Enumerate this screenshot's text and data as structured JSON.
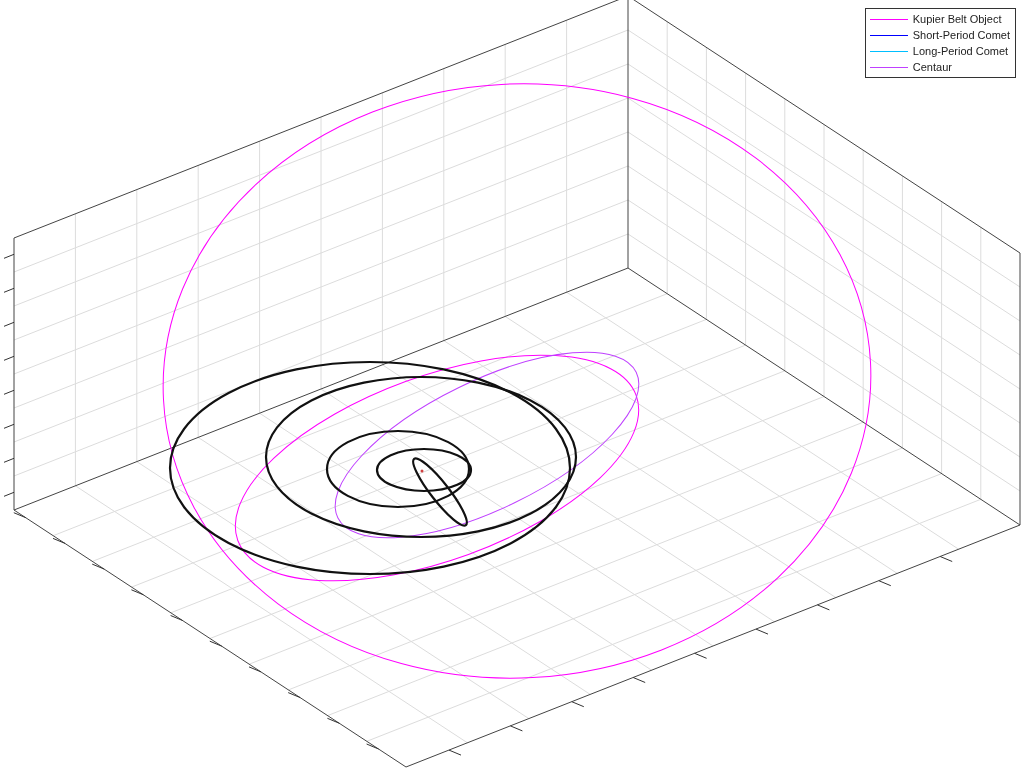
{
  "legend": {
    "entries": [
      {
        "label": "Kupier Belt Object",
        "color": "#ff00ff"
      },
      {
        "label": "Short-Period Comet",
        "color": "#0000ff"
      },
      {
        "label": "Long-Period Comet",
        "color": "#00bfff"
      },
      {
        "label": "Centaur",
        "color": "#bf40ff"
      }
    ]
  }
}
